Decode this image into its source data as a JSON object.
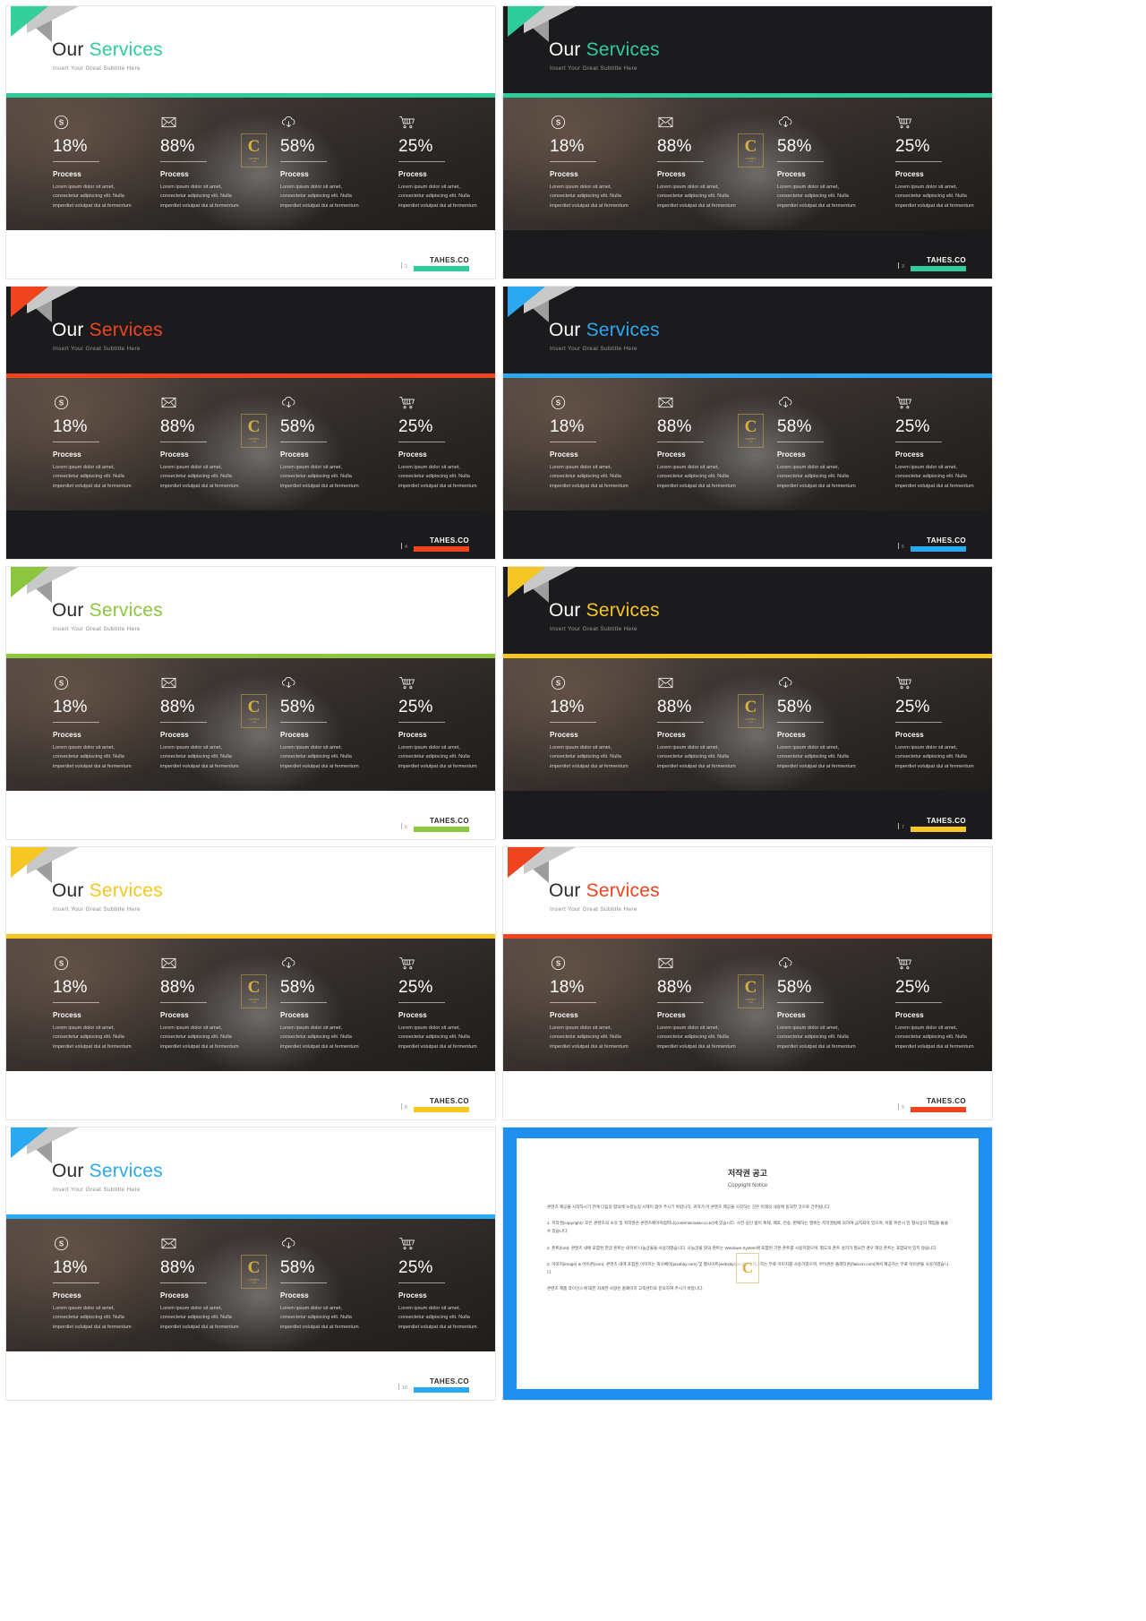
{
  "common": {
    "title_word1": "Our",
    "title_word2": "Services",
    "subtitle": "Insert Your Great Subtitle Here",
    "logo_text": "TAHES.CO",
    "watermark_letter": "C",
    "watermark_line1": "TAHES",
    "watermark_line2": ".CO",
    "stats": [
      {
        "icon": "dollar-circle-icon",
        "percent": "18%",
        "heading": "Process",
        "body": "Lorem ipsum dolor sit amet, consectetur adipiscing elit. Nulla imperdiet volutpat dui at fermentum"
      },
      {
        "icon": "envelope-icon",
        "percent": "88%",
        "heading": "Process",
        "body": "Lorem ipsum dolor sit amet, consectetur adipiscing elit. Nulla imperdiet volutpat dui at fermentum"
      },
      {
        "icon": "cloud-download-icon",
        "percent": "58%",
        "heading": "Process",
        "body": "Lorem ipsum dolor sit amet, consectetur adipiscing elit. Nulla imperdiet volutpat dui at fermentum"
      },
      {
        "icon": "shopping-cart-icon",
        "percent": "25%",
        "heading": "Process",
        "body": "Lorem ipsum dolor sit amet, consectetur adipiscing elit. Nulla imperdiet volutpat dui at fermentum"
      }
    ]
  },
  "slides": [
    {
      "number": "2",
      "accent": "#2ecc9b",
      "theme": "light",
      "ribbon": "#34cf9a"
    },
    {
      "number": "3",
      "accent": "#2ecc9b",
      "theme": "dark",
      "ribbon": "#2ecc9b"
    },
    {
      "number": "4",
      "accent": "#f0441f",
      "theme": "dark",
      "ribbon": "#f0441f"
    },
    {
      "number": "5",
      "accent": "#2aa9f0",
      "theme": "dark",
      "ribbon": "#2aa9f0"
    },
    {
      "number": "6",
      "accent": "#8cc63f",
      "theme": "light",
      "ribbon": "#8cc63f"
    },
    {
      "number": "7",
      "accent": "#f6c622",
      "theme": "dark",
      "ribbon": "#f6c622"
    },
    {
      "number": "8",
      "accent": "#f6c622",
      "theme": "light",
      "ribbon": "#f6c622"
    },
    {
      "number": "9",
      "accent": "#f0441f",
      "theme": "light",
      "ribbon": "#f0441f"
    },
    {
      "number": "10",
      "accent": "#2aa9f0",
      "theme": "light",
      "ribbon": "#2aa9f0"
    }
  ],
  "copyright": {
    "frame_color": "#1f8ff0",
    "title": "저작권 공고",
    "subtitle": "Copyright Notice",
    "paragraphs": [
      "콘텐츠 제공을 시작하시기 전에 다음의 합의에 소정능길 시제이 없어 주시기 바랍니다. 귀하가 이 콘텐츠 제공을 시작하는 것은 이래의 내용에 동의한 것으로 간주됩니다.",
      "1. 저작권(copyright): 모든 콘텐츠의 소유 및 저작권은 콘텐츠메이커컴퍼니(contentsmaker.co.kr)에 있습니다. 사전 승인 없이 복제, 배포, 전송, 판매하는 행위는 저작권법에 의하여 금지되어 있으며, 이를 위반시 민·형사상의 책임을 물을 수 있습니다.",
      "2. 폰트(font): 콘텐츠 내에 포함된 한글 폰트는 네이버 나눔글꼴을 사용하였습니다. 나눔글꼴 외의 폰트는 Windows System에 포함된 기본 폰트를 사용하였으며, 별도의 폰트 설치가 필요한 경우 해당 폰트는 포함되어 있지 않습니다.",
      "3. 이미지(image) & 아이콘(icon): 콘텐츠 내에 포함된 이미지는 픽사베이(pixabay.com) 및 웹사이트(websity.com)에서 제공하는 무료 이미지를 사용하였으며, 아이콘은 플래티콘(flaticon.com)에서 제공하는 무료 아이콘을 사용하였습니다.",
      "콘텐츠 제품 라이선스에 대한 자세한 사항은 홈페이지 고객센터로 문의하여 주시기 바랍니다."
    ],
    "watermark_letter": "C"
  }
}
